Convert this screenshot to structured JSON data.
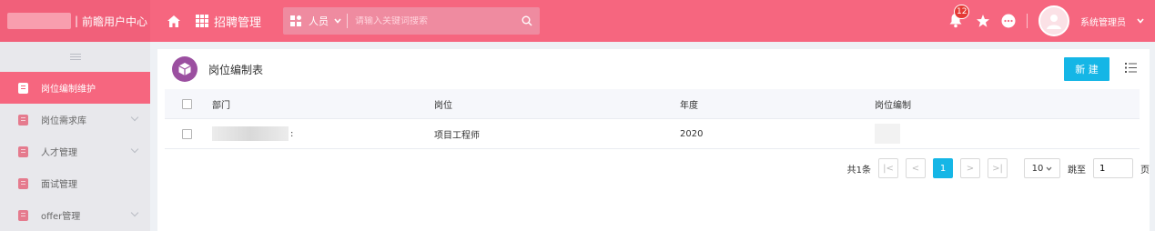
{
  "topbar": {
    "brand_sep": "|",
    "brand_name": "前瞻用户中心",
    "home_icon": "home-icon",
    "apps_icon": "grid-icon",
    "apps_label": "招聘管理",
    "search": {
      "type_label": "人员",
      "placeholder": "请输入关键词搜索"
    },
    "notification_count": "12",
    "user_name": "系统管理员"
  },
  "sidebar": {
    "items": [
      {
        "label": "岗位编制维护",
        "active": true
      },
      {
        "label": "岗位需求库"
      },
      {
        "label": "人才管理"
      },
      {
        "label": "面试管理"
      },
      {
        "label": "offer管理"
      }
    ]
  },
  "main": {
    "title": "岗位编制表",
    "new_button": "新 建",
    "table": {
      "headers": [
        "部门",
        "岗位",
        "年度",
        "岗位编制"
      ],
      "rows": [
        {
          "dept_suffix": ":",
          "post": "项目工程师",
          "year": "2020",
          "quota": ""
        }
      ]
    },
    "pager": {
      "total": "共1条",
      "first": "|<",
      "prev": "<",
      "current": "1",
      "next": ">",
      "last": ">|",
      "page_size": "10",
      "jump_label": "跳至",
      "jump_value": "1",
      "page_unit": "页"
    }
  },
  "colors": {
    "accent": "#f6667f",
    "primary_button": "#15b6e6",
    "header_icon_bg": "#9b4fa0"
  }
}
